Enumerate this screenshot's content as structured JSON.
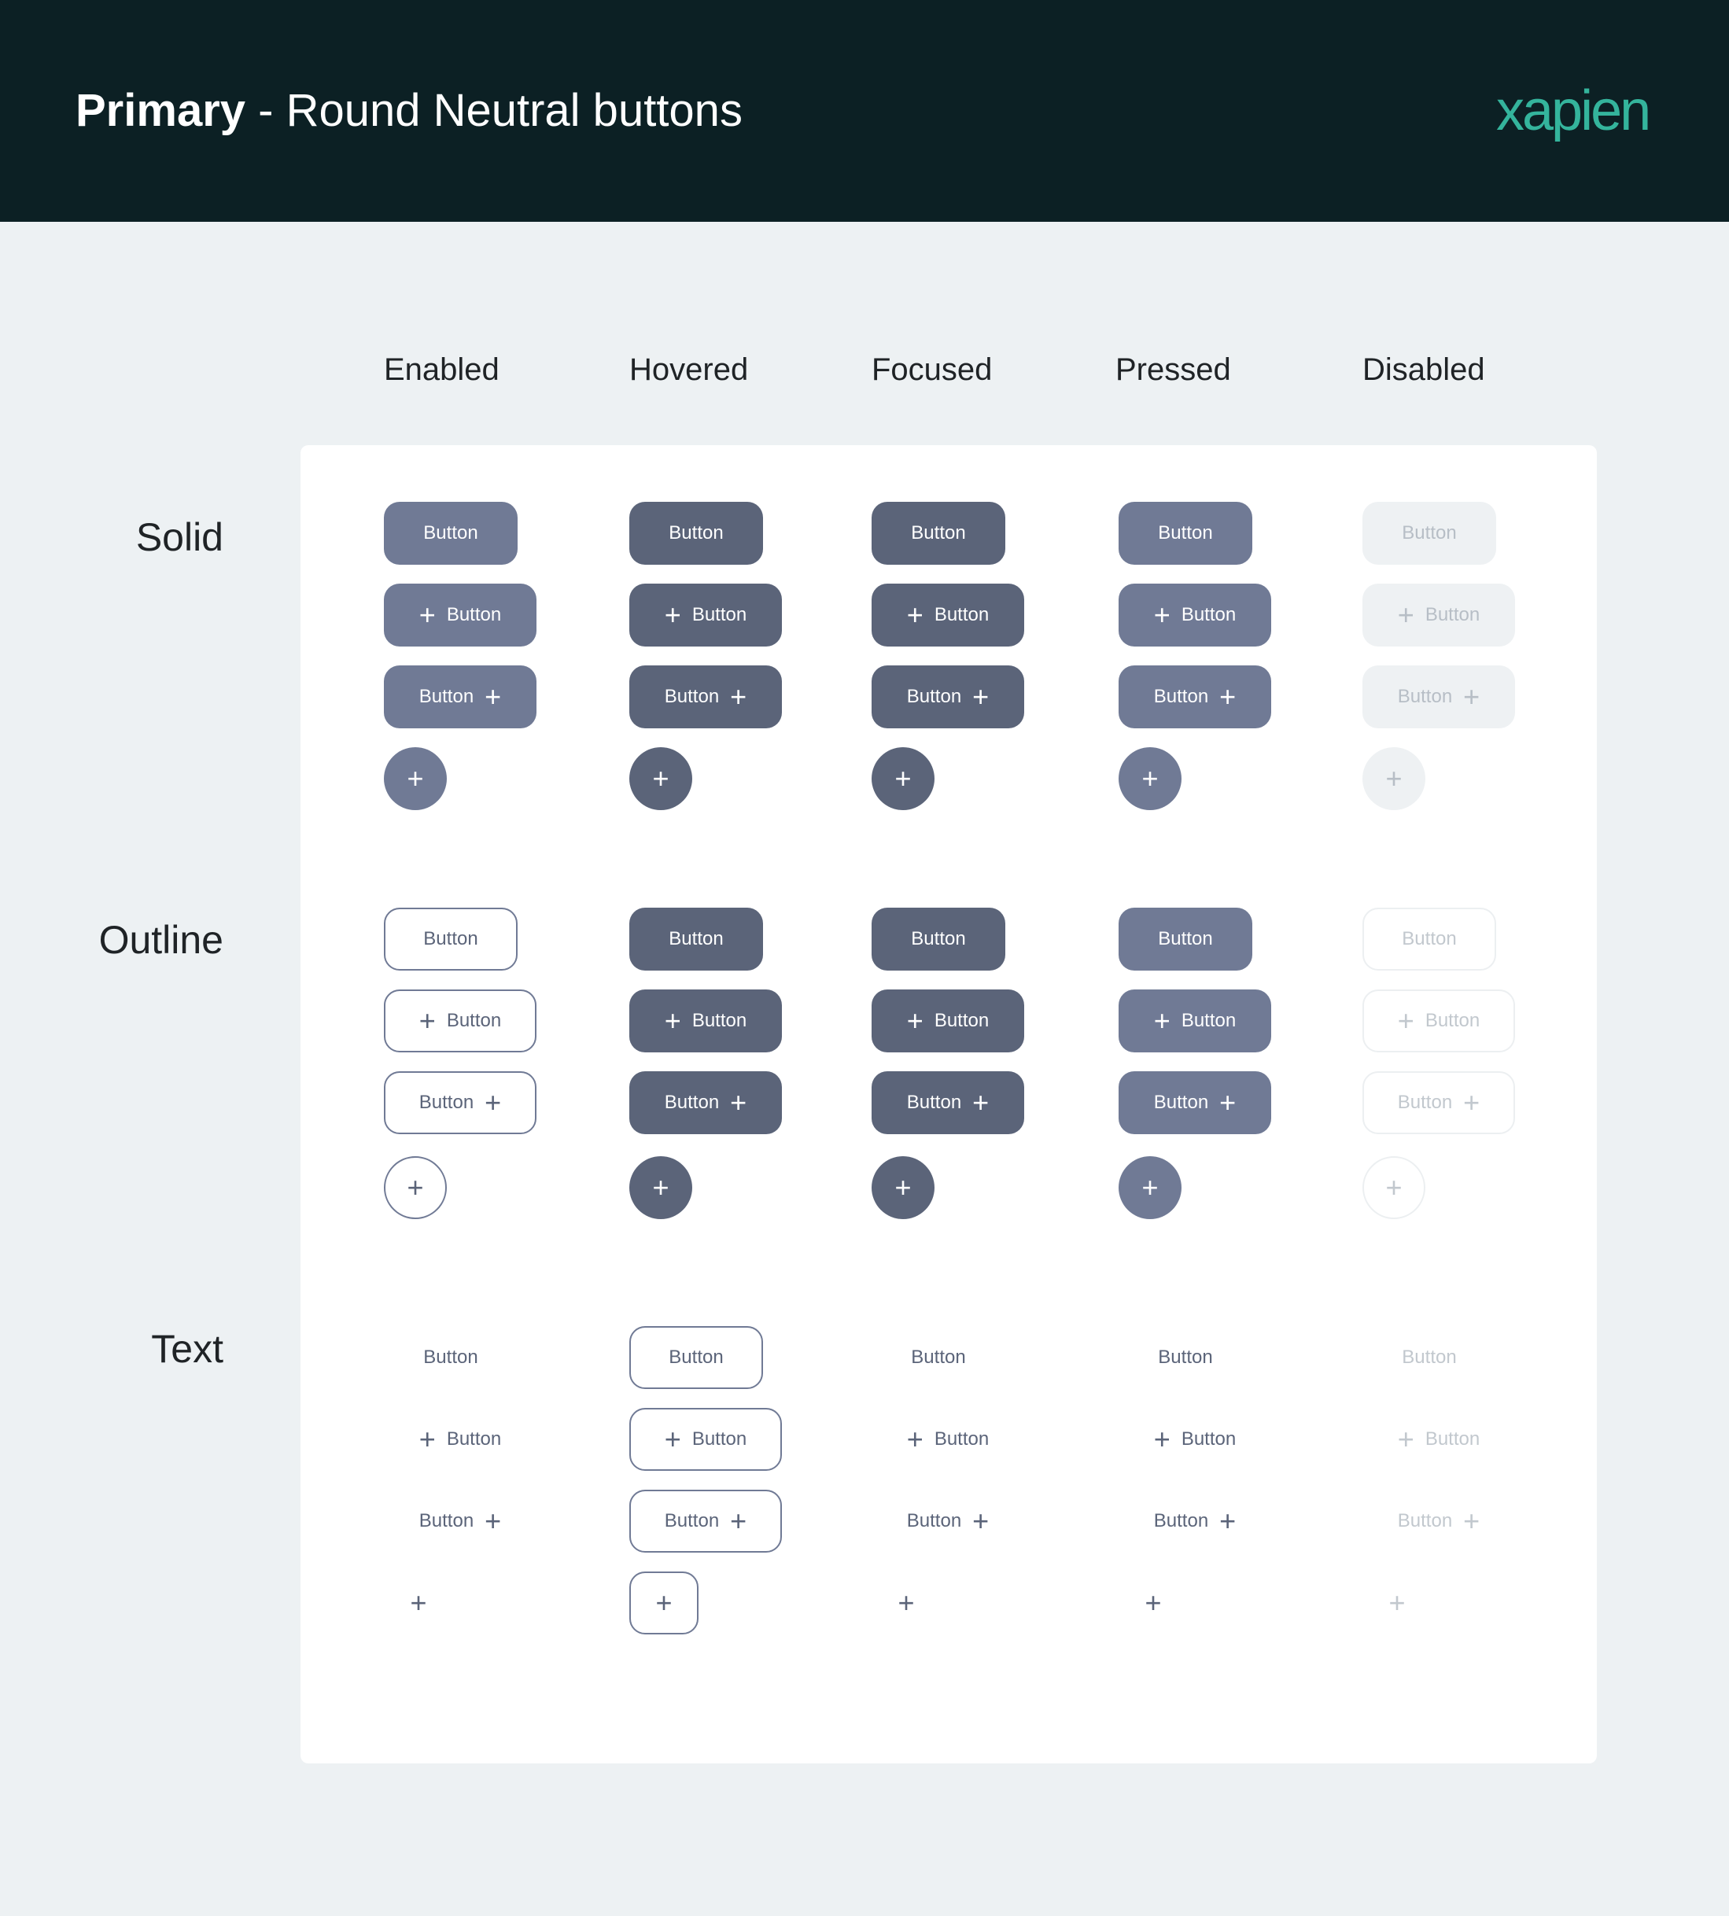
{
  "header": {
    "title_bold": "Primary",
    "title_rest": " - Round Neutral buttons",
    "logo": "xapien"
  },
  "columns": [
    "Enabled",
    "Hovered",
    "Focused",
    "Pressed",
    "Disabled"
  ],
  "rows": [
    "Solid",
    "Outline",
    "Text"
  ],
  "button_label": "Button",
  "icon": {
    "name": "plus-icon",
    "glyph": "+"
  },
  "colors": {
    "header_bg": "#0c2024",
    "logo": "#34b49c",
    "page_bg": "#edf1f3",
    "solid_enabled": "#707a95",
    "solid_hover": "#5b6479",
    "disabled_bg": "#eef1f3",
    "disabled_text": "#b7bec6"
  }
}
